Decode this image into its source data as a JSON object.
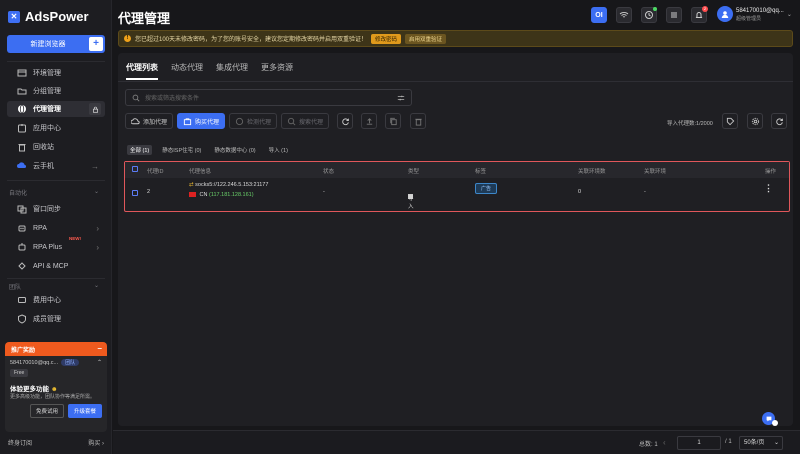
{
  "app": {
    "name": "AdsPower"
  },
  "sidebar": {
    "new_browser": "新建浏览器",
    "items": [
      {
        "label": "环境管理"
      },
      {
        "label": "分组管理"
      },
      {
        "label": "代理管理"
      },
      {
        "label": "应用中心"
      },
      {
        "label": "回收站"
      },
      {
        "label": "云手机"
      }
    ],
    "automation_title": "自动化",
    "automation_items": [
      {
        "label": "窗口同步"
      },
      {
        "label": "RPA"
      },
      {
        "label": "RPA Plus",
        "badge": "NEW!"
      },
      {
        "label": "API & MCP"
      }
    ],
    "team_title": "团队",
    "team_items": [
      {
        "label": "费用中心"
      },
      {
        "label": "成员管理"
      }
    ],
    "promo": {
      "header": "推广奖励",
      "account": "584170010@qq.c...",
      "vip": "团队",
      "plan": "Free",
      "title": "体验更多功能",
      "desc": "更多高级功能，团队协作等满足所需。",
      "btn_trial": "免费试用",
      "btn_upgrade": "升级套餐"
    },
    "footer_left": "终身订阅",
    "footer_right": "购买"
  },
  "header": {
    "title": "代理管理",
    "user_name": "584170010@qq...",
    "user_role": "超级管理员",
    "bell_badge": "2",
    "blue_btn": "OI"
  },
  "notice": {
    "text": "您已超过100天未修改密码，为了您的账号安全，建议您定期修改密码并启用双重验证！",
    "btn_change": "修改密码",
    "btn_2fa": "启用双重验证"
  },
  "main": {
    "tabs": [
      "代理列表",
      "动态代理",
      "集成代理",
      "更多资源"
    ],
    "search_placeholder": "搜索或筛选搜索条件",
    "toolbar": {
      "add_proxy": "添加代理",
      "buy_proxy": "购买代理",
      "check_proxy": "检测代理",
      "search_proxy": "搜索代理"
    },
    "import_count": "导入代理数:1/2000",
    "filters": [
      "全部 (1)",
      "静态ISP住宅 (0)",
      "静态数据中心 (0)",
      "导入 (1)"
    ],
    "table": {
      "headers": [
        "代理ID",
        "代理信息",
        "状态",
        "类型",
        "标签",
        "关联环境数",
        "关联环境",
        "操作"
      ],
      "rows": [
        {
          "id": "2",
          "proxy": "socks5://122.246.5.153:21177",
          "country": "CN",
          "ip": "(117.181.128.161)",
          "status": "-",
          "type": "导入",
          "tag": "广告",
          "env_count": "0",
          "env": "-"
        }
      ]
    }
  },
  "pager": {
    "total": "总数: 1",
    "page": "1",
    "of": "/ 1",
    "per_page": "50条/页"
  },
  "colors": {
    "accent": "#3c6ef2",
    "highlight": "#e0575b",
    "bg": "#17171a"
  }
}
